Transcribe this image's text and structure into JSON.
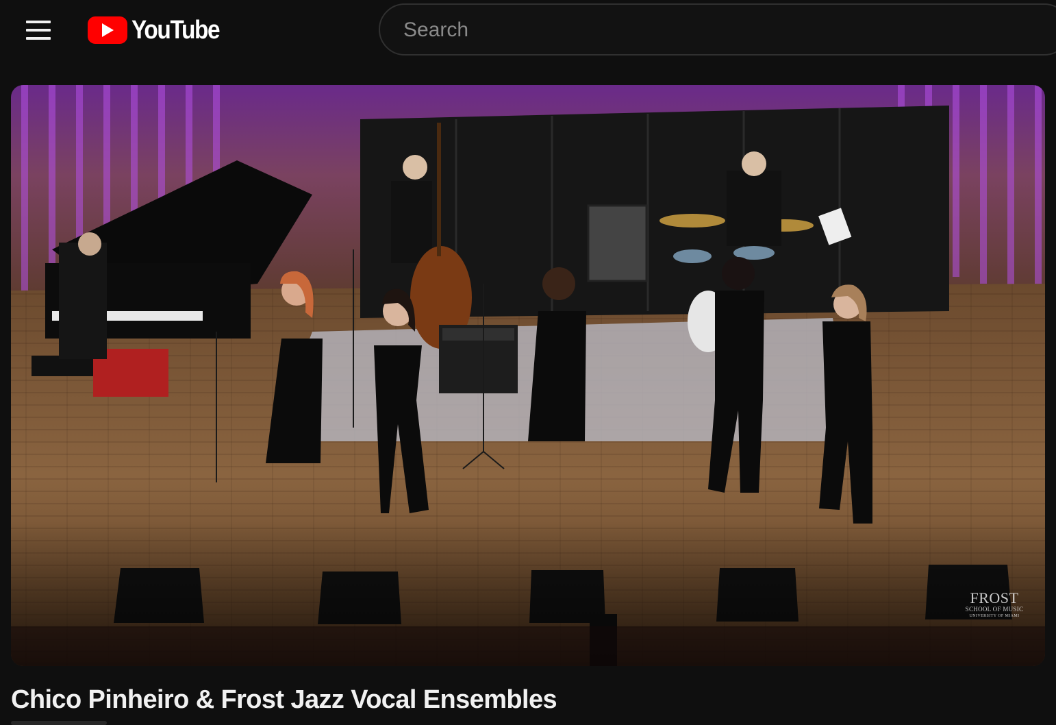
{
  "header": {
    "menu_icon": "hamburger-menu-icon",
    "logo_icon": "youtube-play-icon",
    "logo_text": "YouTube",
    "search_placeholder": "Search"
  },
  "video": {
    "title": "Chico Pinheiro & Frost Jazz Vocal Ensembles",
    "watermark": {
      "line1": "FROST",
      "line2": "SCHOOL OF MUSIC",
      "line3": "UNIVERSITY OF MIAMI"
    }
  },
  "colors": {
    "background": "#0f0f0f",
    "brand_red": "#ff0000",
    "text": "#f1f1f1",
    "placeholder": "#8a8a8a"
  }
}
